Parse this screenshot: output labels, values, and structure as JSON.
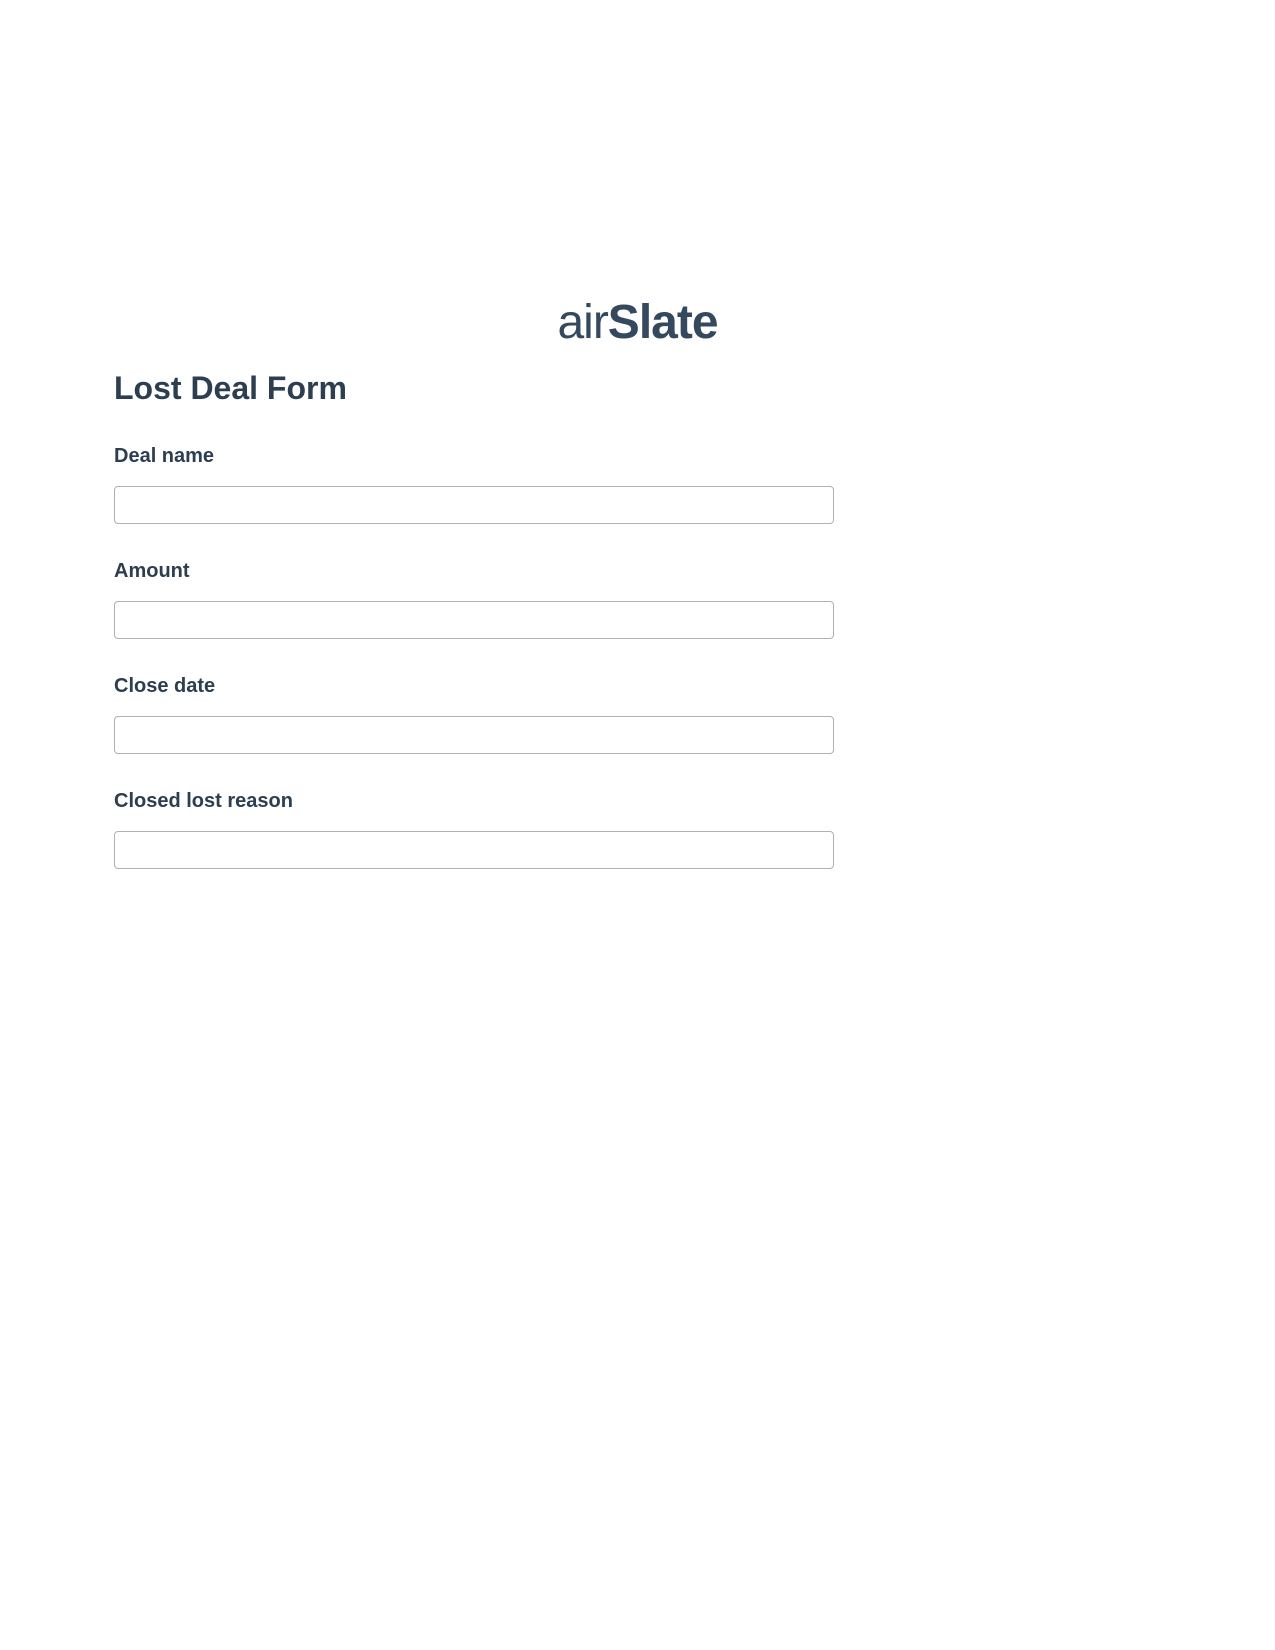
{
  "logo": {
    "prefix": "air",
    "suffix": "Slate"
  },
  "form": {
    "title": "Lost Deal Form",
    "fields": [
      {
        "label": "Deal name",
        "value": ""
      },
      {
        "label": "Amount",
        "value": ""
      },
      {
        "label": "Close date",
        "value": ""
      },
      {
        "label": "Closed lost reason",
        "value": ""
      }
    ]
  }
}
